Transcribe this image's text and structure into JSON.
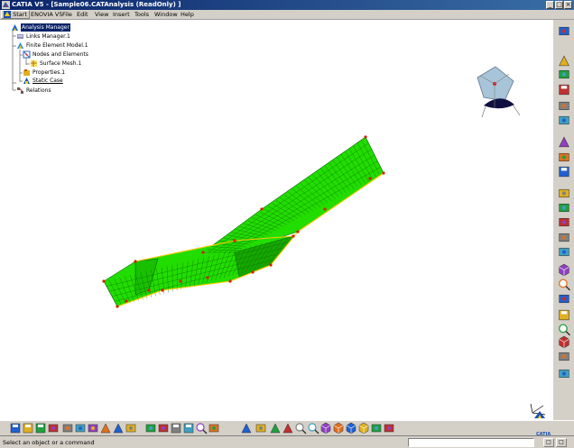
{
  "window": {
    "title": "CATIA V5 - [Sample06.CATAnalysis (ReadOnly) ]",
    "min_glyph": "_",
    "max_glyph": "□",
    "close_glyph": "×"
  },
  "menubar": {
    "items": [
      {
        "label": "Start",
        "icon": "start-icon"
      },
      {
        "label": "ENOVIA V5"
      },
      {
        "label": "File"
      },
      {
        "label": "Edit"
      },
      {
        "label": "View"
      },
      {
        "label": "Insert"
      },
      {
        "label": "Tools"
      },
      {
        "label": "Window"
      },
      {
        "label": "Help"
      }
    ]
  },
  "tree": {
    "nodes": [
      {
        "label": "Analysis Manager",
        "icon": "analysis-manager-icon",
        "selected": true
      },
      {
        "label": "Links Manager.1",
        "icon": "links-manager-icon"
      },
      {
        "label": "Finite Element Model.1",
        "icon": "finite-element-model-icon"
      },
      {
        "label": "Nodes and Elements",
        "icon": "nodes-elements-icon"
      },
      {
        "label": "Surface Mesh.1",
        "icon": "surface-mesh-icon"
      },
      {
        "label": "Properties.1",
        "icon": "properties-icon"
      },
      {
        "label": "Static Case",
        "icon": "static-case-icon",
        "underlined": true
      },
      {
        "label": "Relations",
        "icon": "relations-icon"
      }
    ]
  },
  "compass": {
    "icon": "compass-icon"
  },
  "axis": {
    "icon": "axis-triad-icon"
  },
  "brand": {
    "logo_text": "CATIA"
  },
  "mesh": {
    "fill_color": "#22dd00",
    "grid_color": "#0a6a00",
    "node_color": "#cc2200",
    "edge_color": "#ffcc00"
  },
  "right_toolbar": {
    "icons": [
      "analysis-case-icon",
      "pointer-icon",
      "attach-icon",
      "save-case-icon",
      "lock-icon",
      "material-icon",
      "pencil-icon",
      "restraint-icon",
      "grid-icon",
      "load-icon",
      "force-icon",
      "pressure-icon",
      "distributed-load-icon",
      "connector-icon",
      "virtual-part-icon",
      "compute-icon",
      "image-icon",
      "report-icon",
      "sensor-icon",
      "cube-icon",
      "plot-icon",
      "deformation-icon"
    ]
  },
  "bottom_toolbar": {
    "icons": [
      "new-icon",
      "open-icon",
      "save-icon",
      "print-icon",
      "cut-icon",
      "copy-icon",
      "paste-icon",
      "undo-icon",
      "redo-icon",
      "whats-this-icon",
      "formula-icon",
      "fx-icon",
      "catalog-icon",
      "table-icon",
      "measure-icon",
      "analysis-icon",
      "fly-icon",
      "fit-all-icon",
      "pan-icon",
      "rotate-icon",
      "zoom-in-icon",
      "zoom-out-icon",
      "normal-view-icon",
      "iso-view-icon",
      "shading-icon",
      "hide-show-icon",
      "swap-icon",
      "tools-icon"
    ]
  },
  "status": {
    "message": "Select an object or a command",
    "cmd_btn_a": "□",
    "cmd_btn_b": "□"
  }
}
